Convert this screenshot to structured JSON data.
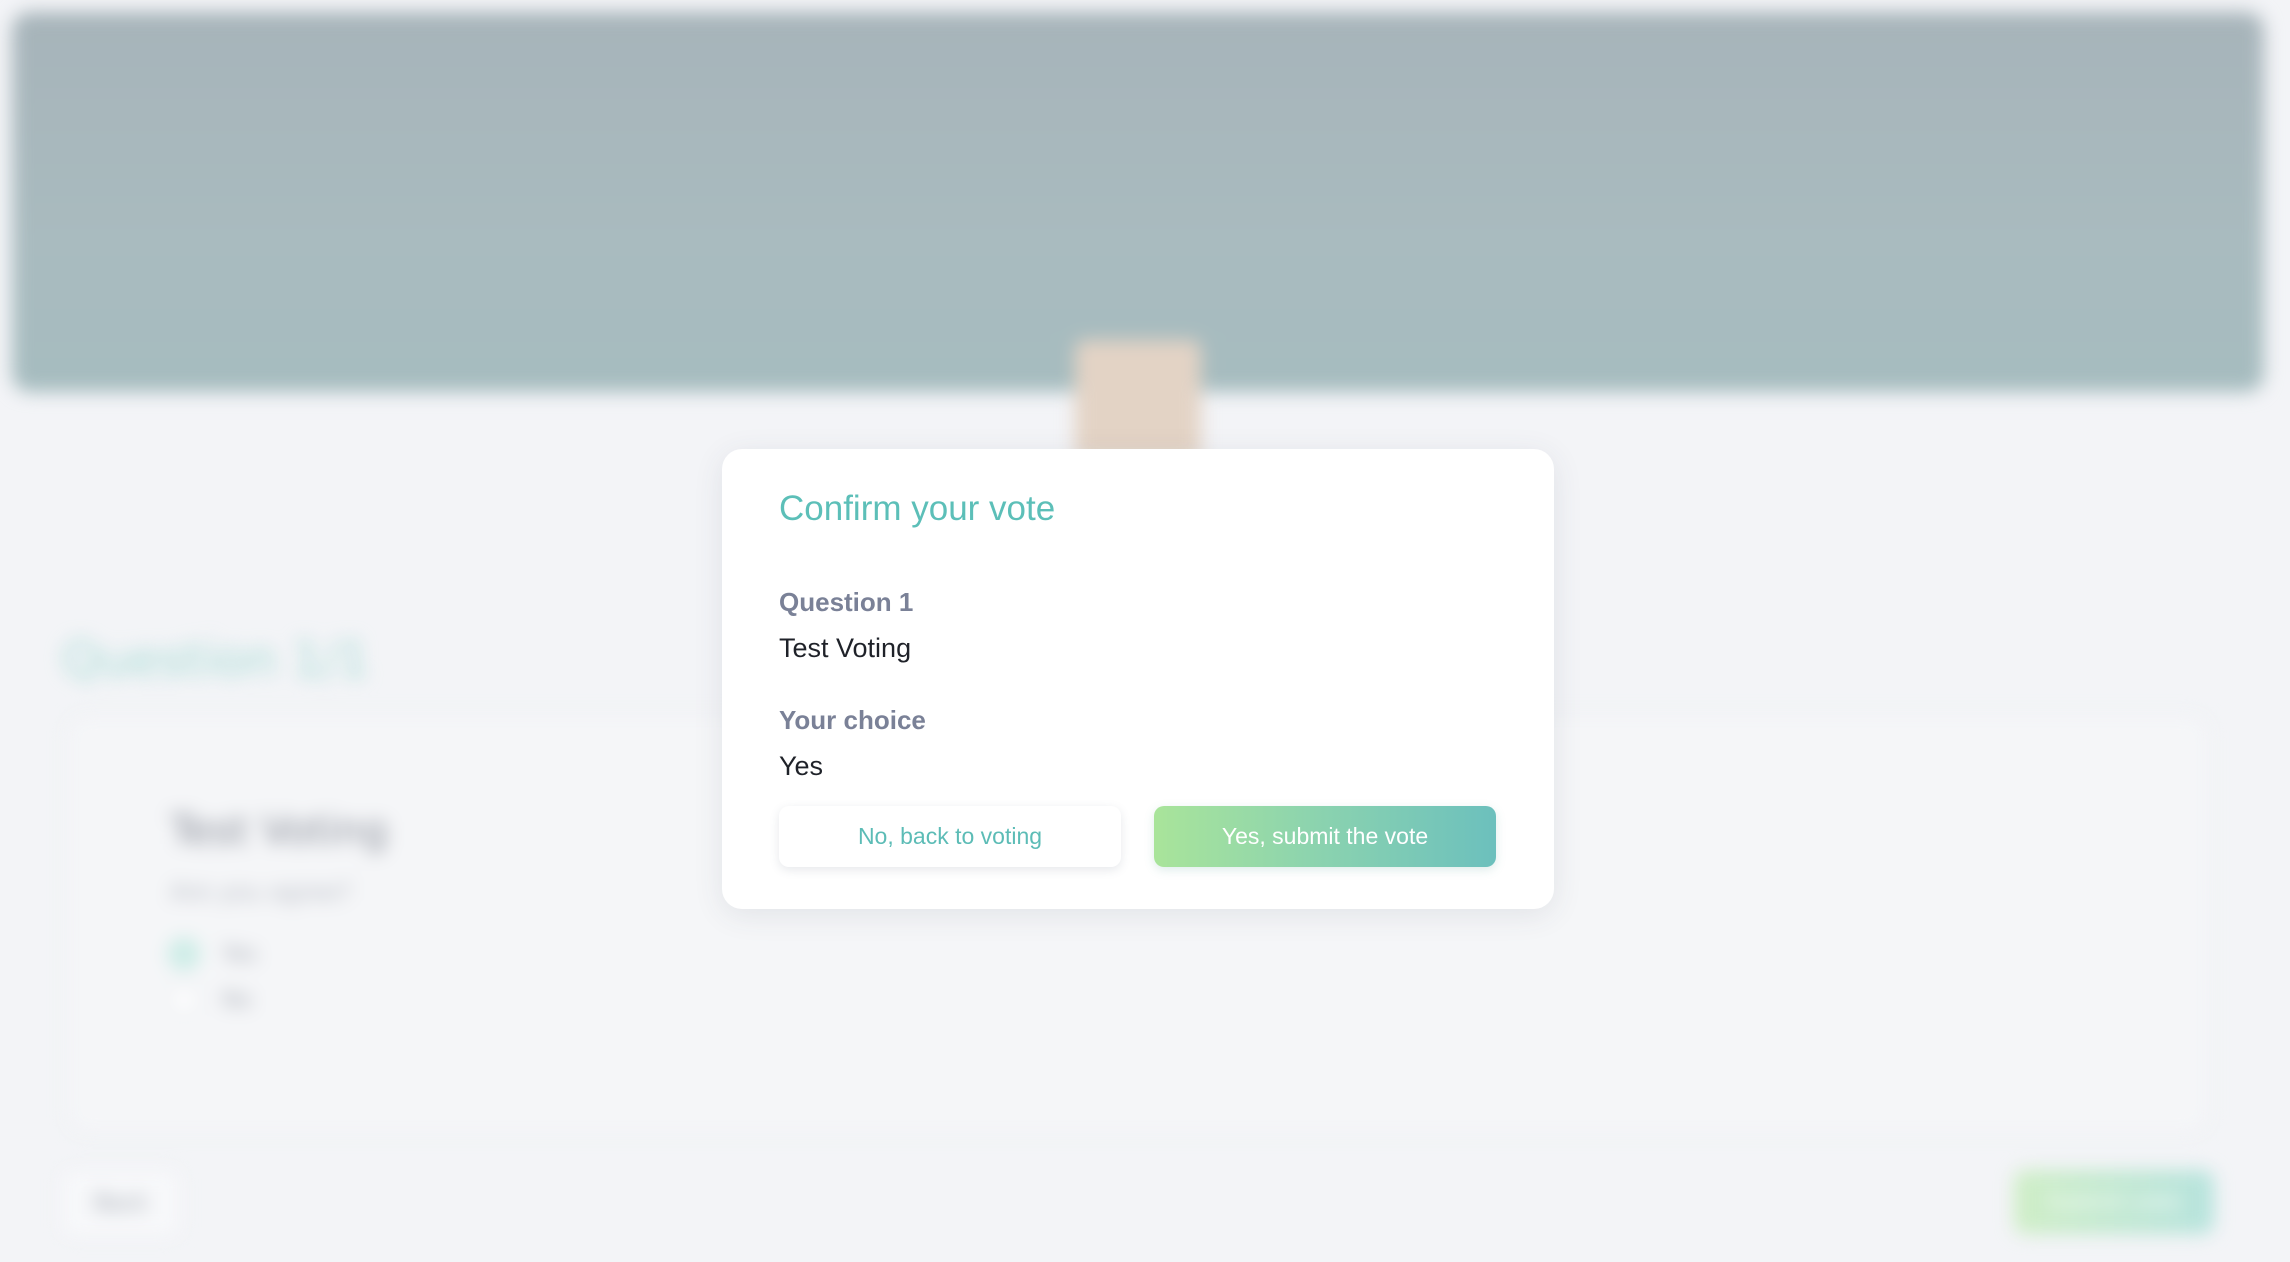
{
  "modal": {
    "title": "Confirm your vote",
    "question_label": "Question 1",
    "question_value": "Test Voting",
    "choice_label": "Your choice",
    "choice_value": "Yes",
    "cancel_label": "No, back to voting",
    "submit_label": "Yes, submit the vote"
  },
  "background": {
    "question_heading": "Question 1/1",
    "card_title": "Test Voting",
    "card_subtitle": "Are you agree?",
    "options": [
      "Yes",
      "No"
    ],
    "selected_option": "Yes",
    "back_label": "Back",
    "next_label": "Submit vote"
  },
  "colors": {
    "accent": "#5cbfb8",
    "label": "#7a8197",
    "submit_gradient_start": "#a9e49a",
    "submit_gradient_end": "#6cc0bd"
  }
}
